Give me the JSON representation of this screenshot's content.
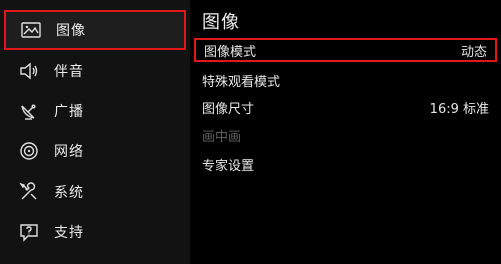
{
  "sidebar": {
    "items": [
      {
        "label": "图像",
        "icon": "picture-icon"
      },
      {
        "label": "伴音",
        "icon": "speaker-icon"
      },
      {
        "label": "广播",
        "icon": "satellite-dish-icon"
      },
      {
        "label": "网络",
        "icon": "network-icon"
      },
      {
        "label": "系统",
        "icon": "tools-icon"
      },
      {
        "label": "支持",
        "icon": "help-icon"
      }
    ],
    "selected_index": 0
  },
  "panel": {
    "title": "图像",
    "rows": [
      {
        "label": "图像模式",
        "value": "动态"
      },
      {
        "label": "特殊观看模式",
        "value": ""
      },
      {
        "label": "图像尺寸",
        "value": "16:9 标准"
      },
      {
        "label": "画中画",
        "value": ""
      },
      {
        "label": "专家设置",
        "value": ""
      }
    ],
    "selected_row": 0,
    "disabled_row": 3
  },
  "colors": {
    "highlight": "#e01818",
    "sidebar_bg": "#121212",
    "panel_bg": "#000000",
    "disabled_text": "#5f5f5f"
  }
}
